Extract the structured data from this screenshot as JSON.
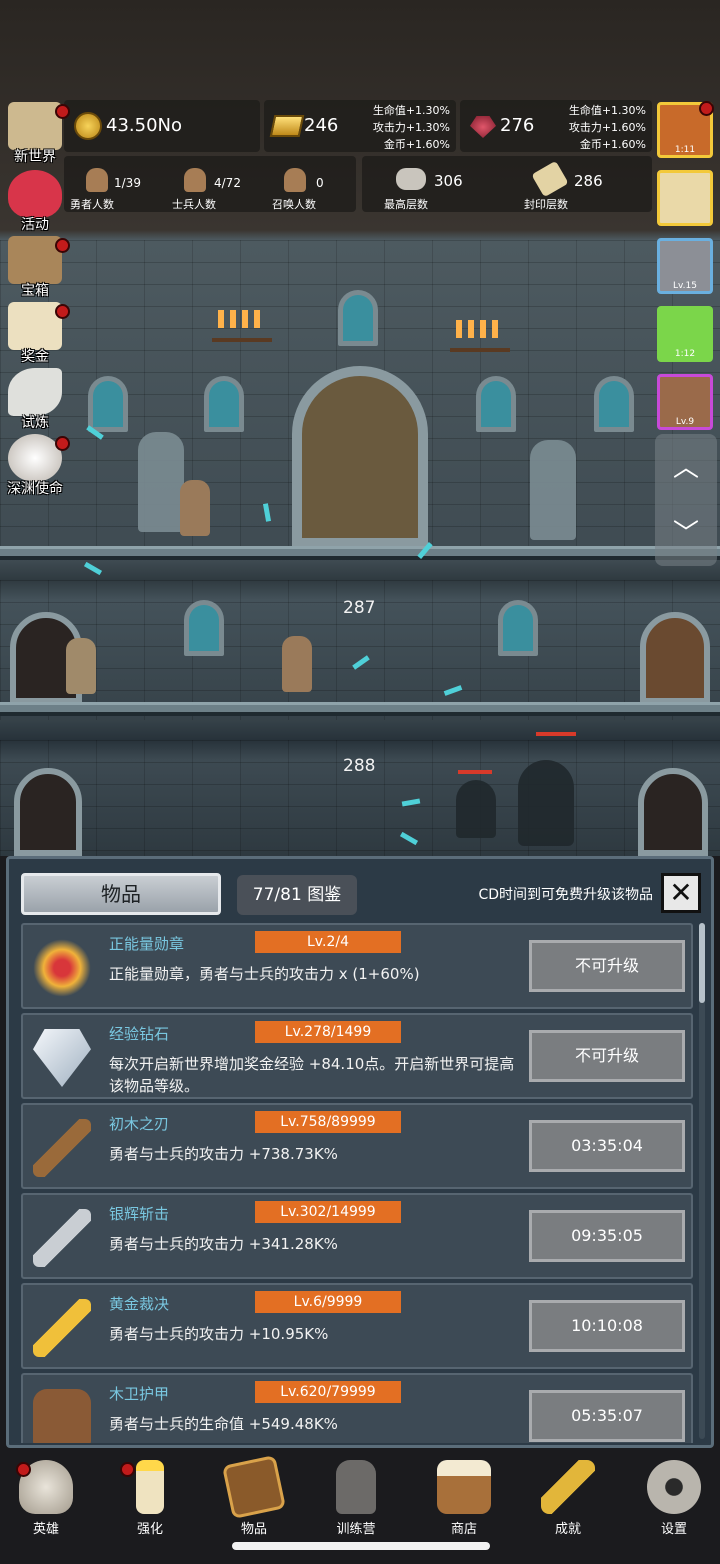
{
  "top_resources": {
    "gold": "43.50No",
    "bars": "246",
    "bars_buff": [
      "生命值+1.30%",
      "攻击力+1.30%",
      "金币+1.60%"
    ],
    "ruby": "276",
    "ruby_buff": [
      "生命值+1.30%",
      "攻击力+1.60%",
      "金币+1.60%"
    ]
  },
  "stats": {
    "heroes": {
      "value": "1/39",
      "label": "勇者人数"
    },
    "soldiers": {
      "value": "4/72",
      "label": "士兵人数"
    },
    "summons": {
      "value": "0",
      "label": "召唤人数"
    },
    "max_floor": {
      "value": "306",
      "label": "最高层数"
    },
    "sealed_floor": {
      "value": "286",
      "label": "封印层数"
    }
  },
  "side_menu": [
    {
      "label": "新世界",
      "icon": "map-icon",
      "badge": true
    },
    {
      "label": "活动",
      "icon": "heart-icon",
      "badge": false
    },
    {
      "label": "宝箱",
      "icon": "chest-icon",
      "badge": true
    },
    {
      "label": "奖金",
      "icon": "envelope-icon",
      "badge": true
    },
    {
      "label": "试炼",
      "icon": "quill-icon",
      "badge": false
    },
    {
      "label": "深渊使命",
      "icon": "pearl-icon",
      "badge": true
    }
  ],
  "buffs": [
    {
      "icon": "onion-icon",
      "label": "1:11"
    },
    {
      "icon": "candle-icon",
      "label": ""
    },
    {
      "icon": "portrait-icon",
      "label": "Lv.15"
    },
    {
      "icon": "slime-icon",
      "label": "1:12"
    },
    {
      "icon": "hero-portrait-icon",
      "label": "Lv.9"
    }
  ],
  "scene": {
    "floor_labels": [
      "287",
      "288"
    ]
  },
  "panel": {
    "title": "物品",
    "codex": "77/81 图鉴",
    "cd_note": "CD时间到可免费升级该物品",
    "close": "✕"
  },
  "items": [
    {
      "name": "正能量勋章",
      "level": "Lv.2/4",
      "desc": "正能量勋章，勇者与士兵的攻击力 x (1+60%)",
      "button": "不可升级",
      "icon": "crown-icon"
    },
    {
      "name": "经验钻石",
      "level": "Lv.278/1499",
      "desc": "每次开启新世界增加奖金经验 +84.10点。开启新世界可提高该物品等级。",
      "button": "不可升级",
      "icon": "diamond-icon"
    },
    {
      "name": "初木之刃",
      "level": "Lv.758/89999",
      "desc": "勇者与士兵的攻击力 +738.73K%",
      "button": "03:35:04",
      "icon": "wood-sword-icon"
    },
    {
      "name": "银辉斩击",
      "level": "Lv.302/14999",
      "desc": "勇者与士兵的攻击力 +341.28K%",
      "button": "09:35:05",
      "icon": "silver-sword-icon"
    },
    {
      "name": "黄金裁决",
      "level": "Lv.6/9999",
      "desc": "勇者与士兵的攻击力 +10.95K%",
      "button": "10:10:08",
      "icon": "gold-sword-icon"
    },
    {
      "name": "木卫护甲",
      "level": "Lv.620/79999",
      "desc": "勇者与士兵的生命值 +549.48K%",
      "button": "05:35:07",
      "icon": "armor-icon"
    }
  ],
  "bottom_nav": [
    {
      "label": "英雄",
      "icon": "skull-icon",
      "badge": true
    },
    {
      "label": "强化",
      "icon": "candle-icon",
      "badge": true
    },
    {
      "label": "物品",
      "icon": "book-icon",
      "badge": false
    },
    {
      "label": "训练营",
      "icon": "lantern-icon",
      "badge": false
    },
    {
      "label": "商店",
      "icon": "mug-icon",
      "badge": false
    },
    {
      "label": "成就",
      "icon": "key-icon",
      "badge": false
    },
    {
      "label": "设置",
      "icon": "gear-icon",
      "badge": false
    }
  ],
  "colors": {
    "level_tag": "#e36f23",
    "item_name": "#79c7e0",
    "badge": "#c21b1b",
    "panel_bg": "#2c3a46"
  }
}
